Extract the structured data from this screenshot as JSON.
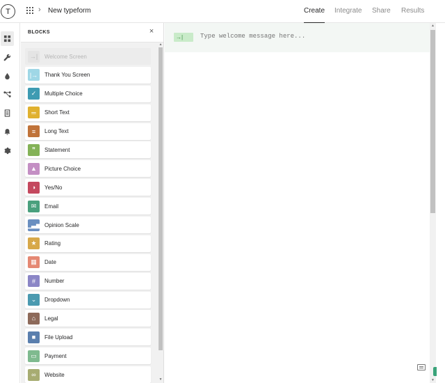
{
  "header": {
    "logo_letter": "T",
    "form_title": "New typeform",
    "tabs": [
      {
        "label": "Create",
        "active": true
      },
      {
        "label": "Integrate",
        "active": false
      },
      {
        "label": "Share",
        "active": false
      },
      {
        "label": "Results",
        "active": false
      }
    ]
  },
  "rail": {
    "items": [
      {
        "icon": "blocks-grid-icon",
        "active": true
      },
      {
        "icon": "wrench-icon",
        "active": false
      },
      {
        "icon": "drop-icon",
        "active": false
      },
      {
        "icon": "logic-branch-icon",
        "active": false
      },
      {
        "icon": "document-icon",
        "active": false
      },
      {
        "icon": "bell-icon",
        "active": false
      },
      {
        "icon": "gear-icon",
        "active": false
      }
    ]
  },
  "panel": {
    "title": "BLOCKS",
    "close_glyph": "×",
    "blocks": [
      {
        "label": "Welcome Screen",
        "glyph": "→|",
        "color": "#e4e4e4",
        "disabled": true
      },
      {
        "label": "Thank You Screen",
        "glyph": "|→",
        "color": "#9fd7e6",
        "disabled": false
      },
      {
        "label": "Multiple Choice",
        "glyph": "✓",
        "color": "#3e9bb2",
        "disabled": false
      },
      {
        "label": "Short Text",
        "glyph": "═",
        "color": "#e0b12f",
        "disabled": false
      },
      {
        "label": "Long Text",
        "glyph": "≡",
        "color": "#c0733a",
        "disabled": false
      },
      {
        "label": "Statement",
        "glyph": "❞",
        "color": "#84b257",
        "disabled": false
      },
      {
        "label": "Picture Choice",
        "glyph": "▲",
        "color": "#c48fc4",
        "disabled": false
      },
      {
        "label": "Yes/No",
        "glyph": "◑",
        "color": "#c4485e",
        "disabled": false
      },
      {
        "label": "Email",
        "glyph": "✉",
        "color": "#49a07d",
        "disabled": false
      },
      {
        "label": "Opinion Scale",
        "glyph": "▁▃▅",
        "color": "#6a8fc0",
        "disabled": false
      },
      {
        "label": "Rating",
        "glyph": "★",
        "color": "#d7a849",
        "disabled": false
      },
      {
        "label": "Date",
        "glyph": "▦",
        "color": "#e58873",
        "disabled": false
      },
      {
        "label": "Number",
        "glyph": "#",
        "color": "#8b86c6",
        "disabled": false
      },
      {
        "label": "Dropdown",
        "glyph": "⌄",
        "color": "#4b9ab0",
        "disabled": false
      },
      {
        "label": "Legal",
        "glyph": "⌂",
        "color": "#8d6a5a",
        "disabled": false
      },
      {
        "label": "File Upload",
        "glyph": "■",
        "color": "#5a7fae",
        "disabled": false
      },
      {
        "label": "Payment",
        "glyph": "▭",
        "color": "#7fba8f",
        "disabled": false
      },
      {
        "label": "Website",
        "glyph": "∞",
        "color": "#a7ac72",
        "disabled": false
      }
    ]
  },
  "canvas": {
    "welcome_badge_glyph": "→|",
    "welcome_placeholder": "Type welcome message here..."
  }
}
